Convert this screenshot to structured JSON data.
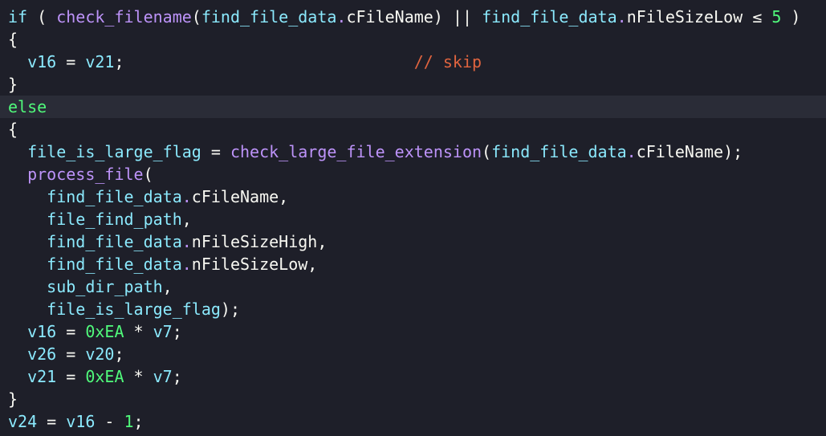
{
  "colors": {
    "background": "#1e1f29",
    "current_line": "#2a2c37",
    "keyword": "#8be9fd",
    "function": "#bd93f9",
    "number": "#50fa7b",
    "comment": "#e0643f",
    "text": "#f8f8f2"
  },
  "code": {
    "l1": {
      "kw": "if",
      "p_open": " ( ",
      "fn": "check_filename",
      "a1": "(",
      "v1": "find_file_data",
      "d1": ".",
      "f1": "cFileName",
      "a2": ") || ",
      "v2": "find_file_data",
      "d2": ".",
      "f2": "nFileSizeLow",
      "op": " ≤ ",
      "num": "5",
      "close": " )"
    },
    "l2": "{",
    "l3": {
      "indent": "  ",
      "v1": "v16",
      "eq": " = ",
      "v2": "v21",
      "semi": ";",
      "pad": "                              ",
      "comment": "// skip"
    },
    "l4": "}",
    "l5": "else",
    "l6": "{",
    "l7": {
      "indent": "  ",
      "v1": "file_is_large_flag",
      "eq": " = ",
      "fn": "check_large_file_extension",
      "a1": "(",
      "v2": "find_file_data",
      "d1": ".",
      "f1": "cFileName",
      "end": ");"
    },
    "l8": {
      "indent": "  ",
      "fn": "process_file",
      "open": "("
    },
    "l9": {
      "indent": "    ",
      "v": "find_file_data",
      "d": ".",
      "f": "cFileName",
      "end": ","
    },
    "l10": {
      "indent": "    ",
      "v": "file_find_path",
      "end": ","
    },
    "l11": {
      "indent": "    ",
      "v": "find_file_data",
      "d": ".",
      "f": "nFileSizeHigh",
      "end": ","
    },
    "l12": {
      "indent": "    ",
      "v": "find_file_data",
      "d": ".",
      "f": "nFileSizeLow",
      "end": ","
    },
    "l13": {
      "indent": "    ",
      "v": "sub_dir_path",
      "end": ","
    },
    "l14": {
      "indent": "    ",
      "v": "file_is_large_flag",
      "end": ");"
    },
    "l15": {
      "indent": "  ",
      "v1": "v16",
      "eq": " = ",
      "num": "0xEA",
      "op": " * ",
      "v2": "v7",
      "end": ";"
    },
    "l16": {
      "indent": "  ",
      "v1": "v26",
      "eq": " = ",
      "v2": "v20",
      "end": ";"
    },
    "l17": {
      "indent": "  ",
      "v1": "v21",
      "eq": " = ",
      "num": "0xEA",
      "op": " * ",
      "v2": "v7",
      "end": ";"
    },
    "l18": "}",
    "l19": {
      "v1": "v24",
      "eq": " = ",
      "v2": "v16",
      "op": " - ",
      "num": "1",
      "end": ";"
    }
  }
}
